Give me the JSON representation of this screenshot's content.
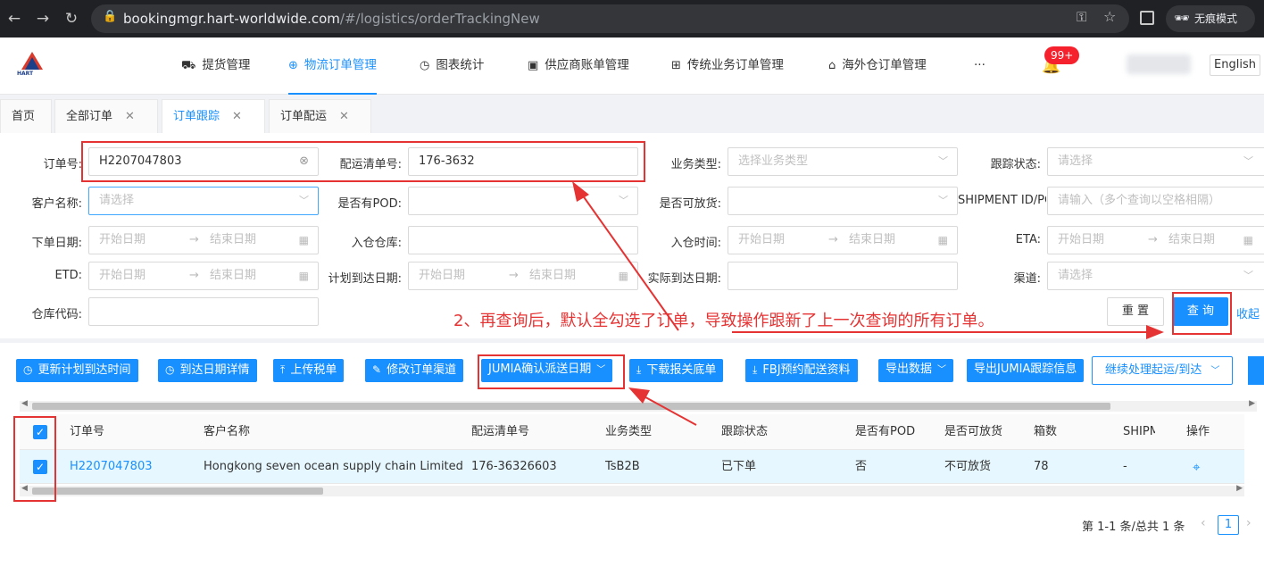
{
  "browser": {
    "url_host": "bookingmgr.hart-worldwide.com",
    "url_path": "/#/logistics/orderTrackingNew",
    "incognito_label": "无痕模式"
  },
  "header": {
    "logo_text": "HART",
    "nav": [
      {
        "label": "提货管理",
        "icon": "truck-icon"
      },
      {
        "label": "物流订单管理",
        "icon": "globe-icon"
      },
      {
        "label": "图表统计",
        "icon": "clock-icon"
      },
      {
        "label": "供应商账单管理",
        "icon": "invoice-icon"
      },
      {
        "label": "传统业务订单管理",
        "icon": "sitemap-icon"
      },
      {
        "label": "海外仓订单管理",
        "icon": "home-icon"
      }
    ],
    "more": "···",
    "notification_badge": "99+",
    "language": "English"
  },
  "tabs": [
    {
      "label": "首页",
      "closable": false
    },
    {
      "label": "全部订单",
      "closable": true
    },
    {
      "label": "订单跟踪",
      "closable": true
    },
    {
      "label": "订单配运",
      "closable": true
    }
  ],
  "filters": {
    "order_no": {
      "label": "订单号:",
      "value": "H2207047803"
    },
    "dispatch_no": {
      "label": "配运清单号:",
      "value": "176-3632"
    },
    "biz_type": {
      "label": "业务类型:",
      "placeholder": "选择业务类型"
    },
    "track_status": {
      "label": "跟踪状态:",
      "placeholder": "请选择"
    },
    "customer": {
      "label": "客户名称:",
      "placeholder": "请选择"
    },
    "has_pod": {
      "label": "是否有POD:"
    },
    "can_release": {
      "label": "是否可放货:"
    },
    "shipment_id": {
      "label": "SHIPMENT ID/PO",
      "placeholder": "请输入（多个查询以空格相隔）"
    },
    "order_date": {
      "label": "下单日期:"
    },
    "warehouse_in": {
      "label": "入仓仓库:"
    },
    "in_time": {
      "label": "入仓时间:"
    },
    "eta": {
      "label": "ETA:"
    },
    "etd": {
      "label": "ETD:"
    },
    "planned_arrival": {
      "label": "计划到达日期:"
    },
    "actual_arrival": {
      "label": "实际到达日期:"
    },
    "channel": {
      "label": "渠道:",
      "placeholder": "请选择"
    },
    "warehouse_code": {
      "label": "仓库代码:"
    },
    "start_date": "开始日期",
    "end_date": "结束日期",
    "arrow": "→",
    "reset": "重 置",
    "query": "查 询",
    "collapse": "收起"
  },
  "annotation_text": "2、再查询后，默认全勾选了订单，导致操作跟新了上一次查询的所有订单。",
  "toolbar": [
    {
      "label": "更新计划到达时间",
      "icon": "clock-icon"
    },
    {
      "label": "到达日期详情",
      "icon": "clock-icon"
    },
    {
      "label": "上传税单",
      "icon": "upload-icon"
    },
    {
      "label": "修改订单渠道",
      "icon": "edit-icon"
    },
    {
      "label": "JUMIA确认派送日期",
      "icon": "chevron-down-icon"
    },
    {
      "label": "下载报关底单",
      "icon": "download-icon"
    },
    {
      "label": "FBJ预约配送资料",
      "icon": "download-icon"
    },
    {
      "label": "导出数据",
      "icon": "chevron-down-icon"
    },
    {
      "label": "导出JUMIA跟踪信息",
      "icon": ""
    },
    {
      "label": "继续处理起运/到达",
      "icon": "chevron-down-icon"
    }
  ],
  "table": {
    "columns": [
      "订单号",
      "客户名称",
      "配运清单号",
      "业务类型",
      "跟踪状态",
      "是否有POD",
      "是否可放货",
      "箱数",
      "SHIPM",
      "操作"
    ],
    "rows": [
      [
        "H2207047803",
        "Hongkong seven ocean supply chain Limited",
        "176-36326603",
        "TsB2B",
        "已下单",
        "否",
        "不可放货",
        "78",
        "-",
        ""
      ]
    ]
  },
  "pagination": {
    "summary": "第 1-1 条/总共 1 条",
    "prev": "‹",
    "current": "1",
    "next": "›"
  },
  "colors": {
    "primary": "#1890ff",
    "annotation_red": "#e53333"
  }
}
